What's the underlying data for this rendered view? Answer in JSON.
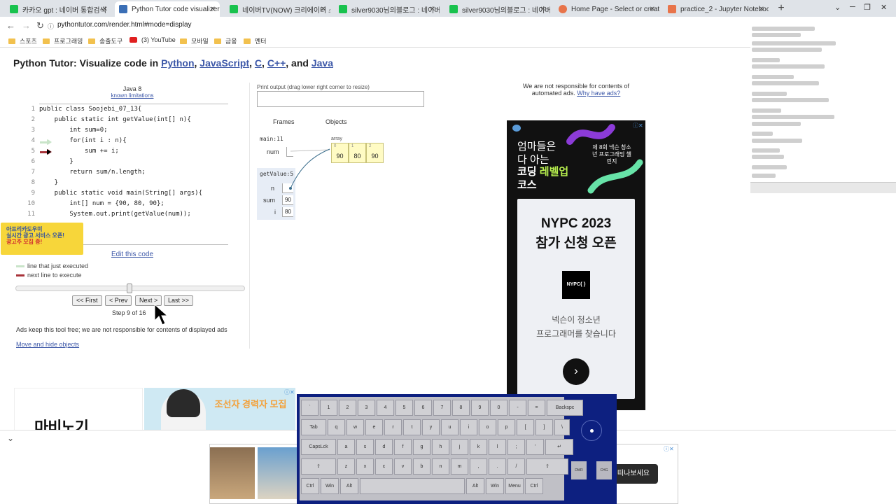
{
  "browser": {
    "tabs": [
      {
        "label": "카카오 gpt : 네이버 통합검색",
        "color": "#19c24e",
        "active": false
      },
      {
        "label": "Python Tutor code visualizer: V",
        "color": "#3b6fb6",
        "active": true
      },
      {
        "label": "네이버TV(NOW) 크리에이터 스",
        "color": "#19c24e",
        "active": false
      },
      {
        "label": "silver9030님의블로그 : 네이버",
        "color": "#19c24e",
        "active": false
      },
      {
        "label": "silver9030님의블로그 : 네이버",
        "color": "#19c24e",
        "active": false
      },
      {
        "label": "Home Page - Select or create",
        "color": "#e8744a",
        "active": false
      },
      {
        "label": "practice_2 - Jupyter Notebook",
        "color": "#e8744a",
        "active": false
      }
    ],
    "url": "pythontutor.com/render.html#mode=display",
    "bookmarks": [
      "스포츠",
      "프로그래밍",
      "송출도구",
      "(3) YouTube",
      "모바일",
      "금융",
      "멘터"
    ]
  },
  "page": {
    "title_prefix": "Python Tutor: Visualize code in ",
    "lang1": "Python",
    "sep1": ", ",
    "lang2": "JavaScript",
    "sep2": ", ",
    "lang3": "C",
    "sep3": ", ",
    "lang4": "C++",
    "sep4": ", and ",
    "lang5": "Java"
  },
  "code_panel": {
    "language": "Java 8",
    "limitations": "known limitations",
    "lines": [
      "public class Soojebi_07_13{",
      "    public static int getValue(int[] n){",
      "        int sum=0;",
      "        for(int i : n){",
      "            sum += i;",
      "        }",
      "        return sum/n.length;",
      "    }",
      "    public static void main(String[] args){",
      "        int[] num = {90, 80, 90};",
      "        System.out.print(getValue(num));"
    ],
    "line_numbers": [
      "1",
      "2",
      "3",
      "4",
      "5",
      "6",
      "7",
      "8",
      "9",
      "10",
      "11"
    ],
    "edit_link": "Edit this code",
    "legend_executed": "line that just executed",
    "legend_next": "next line to execute",
    "btn_first": "<< First",
    "btn_prev": "< Prev",
    "btn_next": "Next >",
    "btn_last": "Last >>",
    "step": "Step 9 of 16",
    "ads_note": "Ads keep this tool free; we are not responsible for contents of displayed ads",
    "move_link": "Move and hide objects"
  },
  "kakao_ad": {
    "line1": "아프리카도우미",
    "line2": "실시간 광고 서비스 오픈!",
    "line3": "광고주 모집 중!"
  },
  "visualizer": {
    "print_label": "Print output (drag lower right corner to resize)",
    "frames_header": "Frames",
    "objects_header": "Objects",
    "frame_main": "main:11",
    "main_var": "num",
    "frame_get": "getValue:5",
    "get_vars": [
      {
        "name": "n",
        "value": ""
      },
      {
        "name": "sum",
        "value": "90"
      },
      {
        "name": "i",
        "value": "80"
      }
    ],
    "array_label": "array",
    "array": [
      {
        "index": "0",
        "value": "90"
      },
      {
        "index": "1",
        "value": "80"
      },
      {
        "index": "2",
        "value": "90"
      }
    ]
  },
  "ads": {
    "notice": "We are not responsible for contents of automated ads. ",
    "why": "Why have ads?",
    "nypc_head1": "엄마들은",
    "nypc_head1b": "다 아는",
    "nypc_head2a": "코딩 ",
    "nypc_head2b": "레벨업",
    "nypc_head2c": "코스",
    "nypc_side": "제 8회 넥슨 청소년 프로그래밍 챌린지",
    "nypc_title1": "NYPC 2023",
    "nypc_title2": "참가 신청 오픈",
    "nypc_logo": "NYPC{ }",
    "nypc_desc1": "넥슨이 청소년",
    "nypc_desc2": "프로그래머를 찾습니다",
    "nypc_go": "›",
    "mabiz_logo": "마비노기",
    "game_sign": "조선자 경력자 모집",
    "cta": "떠나보세요"
  },
  "keyboard": {
    "row1": [
      "`",
      "1",
      "2",
      "3",
      "4",
      "5",
      "6",
      "7",
      "8",
      "9",
      "0",
      "-",
      "=",
      "Backspc"
    ],
    "row2": [
      "Tab",
      "q",
      "w",
      "e",
      "r",
      "t",
      "y",
      "u",
      "i",
      "o",
      "p",
      "[",
      "]",
      "\\"
    ],
    "row3": [
      "CapsLck",
      "a",
      "s",
      "d",
      "f",
      "g",
      "h",
      "j",
      "k",
      "l",
      ";",
      "'",
      "↵"
    ],
    "row4": [
      "⇧",
      "z",
      "x",
      "c",
      "v",
      "b",
      "n",
      "m",
      ",",
      ".",
      "/",
      "⇧"
    ],
    "row5": [
      "Ctrl",
      "Win",
      "Alt",
      "",
      "Alt",
      "Win",
      "Menu",
      "Ctrl"
    ],
    "side1": "DMR",
    "side2": "CHG"
  }
}
